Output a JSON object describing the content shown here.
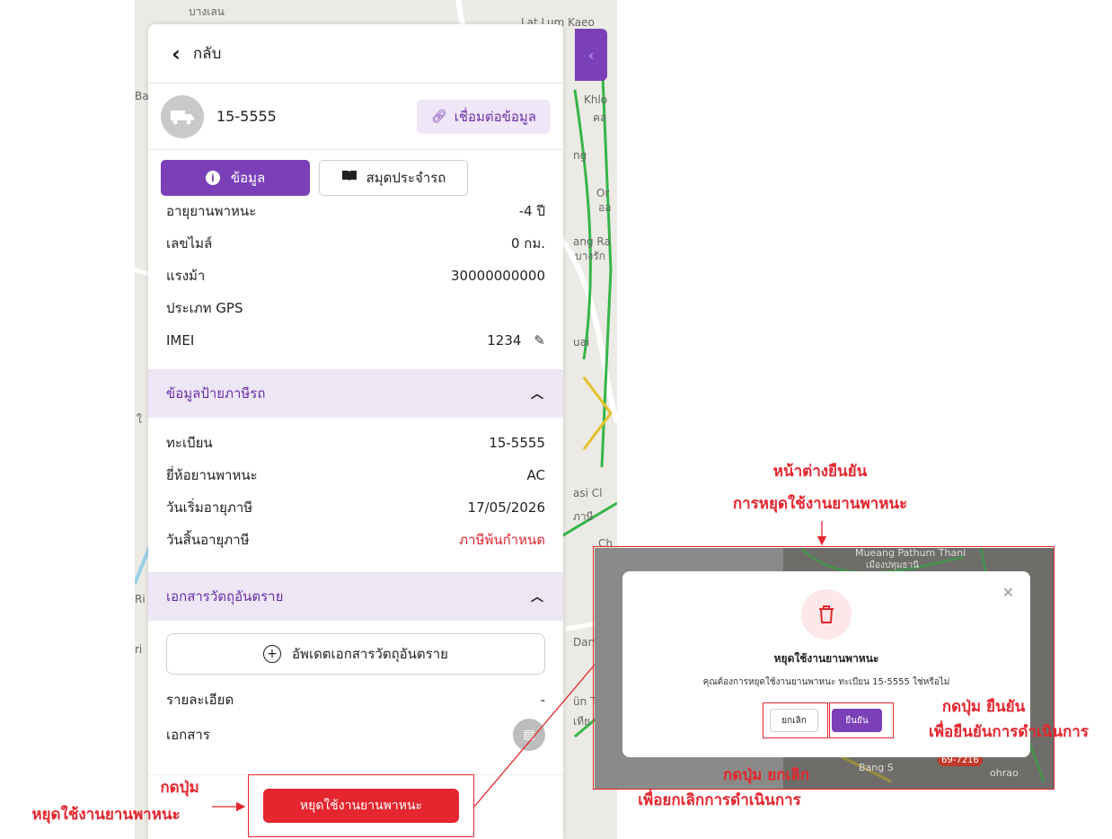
{
  "map": {
    "labels": [
      "บางเลน",
      "Lat Lum Kaeo",
      "Khlo",
      "คล",
      "ng",
      "Or",
      "ออ",
      "ang Ra",
      "บางรัก",
      "uai",
      "asi Cl",
      "ภาษี",
      "Ch",
      "Dam",
      "ün T",
      "เทีย",
      "Ba",
      "ใ",
      "Ri",
      "ri",
      "Mueang Pathum Thani",
      "เมืองปทุมธานี",
      "Bang S",
      "ohrao",
      "69-7216"
    ]
  },
  "panel": {
    "back_label": "กลับ",
    "plate": "15-5555",
    "connect_label": "เชื่อมต่อข้อมูล",
    "tabs": [
      {
        "label": "ข้อมูล",
        "active": true
      },
      {
        "label": "สมุดประจำรถ",
        "active": false
      }
    ],
    "vehicle_info": [
      {
        "label": "อายุยานพาหนะ",
        "value": "-4 ปี"
      },
      {
        "label": "เลขไมล์",
        "value": "0 กม."
      },
      {
        "label": "แรงม้า",
        "value": "30000000000"
      },
      {
        "label": "ประเภท GPS",
        "value": ""
      },
      {
        "label": "IMEI",
        "value": "1234"
      }
    ],
    "tax_section": {
      "title": "ข้อมูลป้ายภาษีรถ",
      "rows": [
        {
          "label": "ทะเบียน",
          "value": "15-5555"
        },
        {
          "label": "ยี่ห้อยานพาหนะ",
          "value": "AC"
        },
        {
          "label": "วันเริ่มอายุภาษี",
          "value": "17/05/2026"
        },
        {
          "label": "วันสิ้นอายุภาษี",
          "value": "ภาษีพ้นกำหนด"
        }
      ]
    },
    "hazard_section": {
      "title": "เอกสารวัตถุอันตราย",
      "upload_label": "อัพเดตเอกสารวัตถุอันตราย",
      "rows": [
        {
          "label": "รายละเอียด",
          "value": "-"
        },
        {
          "label": "เอกสาร",
          "value": ""
        }
      ]
    },
    "stop_button": "หยุดใช้งานยานพาหนะ"
  },
  "annotations": {
    "press_button_line1": "กดปุ่ม",
    "press_button_line2": "หยุดใช้งานยานพาหนะ",
    "dialog_title_line1": "หน้าต่างยืนยัน",
    "dialog_title_line2": "การหยุดใช้งานยานพาหนะ",
    "confirm_note_line1": "กดปุ่ม ยืนยัน",
    "confirm_note_line2": "เพื่อยืนยันการดำเนินการ",
    "cancel_note_line1": "กดปุ่ม ยกเลิก",
    "cancel_note_line2": "เพื่อยกเลิกการดำเนินการ"
  },
  "modal": {
    "title": "หยุดใช้งานยานพาหนะ",
    "message": "คุณต้องการหยุดใช้งานยานพาหนะ ทะเบียน 15-5555 ใช่หรือไม่",
    "cancel_label": "ยกเลิก",
    "confirm_label": "ยืนยัน"
  },
  "colors": {
    "accent": "#7b3fb8",
    "danger": "#e5262e",
    "section_bg": "#ece6f5"
  }
}
